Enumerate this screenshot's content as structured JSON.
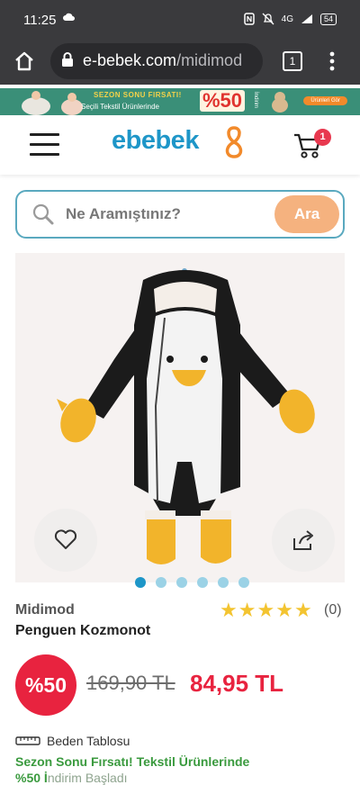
{
  "status": {
    "time": "11:25",
    "lte": "4G",
    "battery": "54"
  },
  "browser": {
    "host": "e-bebek.com",
    "path": "/midimod",
    "tab_count": "1"
  },
  "banner": {
    "line1": "SEZON SONU FIRSATI!",
    "line2": "Seçili Tekstil Ürünlerinde",
    "percent": "%50",
    "suffix": "İndirim",
    "cta": "Ürünleri Gör"
  },
  "header": {
    "logo": "ebebek",
    "cart_count": "1"
  },
  "search": {
    "placeholder": "Ne Aramıştınız?",
    "button": "Ara"
  },
  "gallery": {
    "slides": 6,
    "active_slide": 0
  },
  "product": {
    "brand": "Midimod",
    "name": "Penguen Kozmonot",
    "rating_count": "(0)",
    "rating": 0,
    "discount": "%50",
    "old_price": "169,90 TL",
    "new_price": "84,95 TL"
  },
  "links": {
    "size_chart": "Beden Tablosu",
    "promo": "Sezon Sonu Fırsatı! Tekstil Ürünlerinde",
    "promo2": "%50 İ",
    "promo2_rest": "ndirim Başladı"
  },
  "colors": {
    "brand_blue": "#1e96c8",
    "sale_red": "#e8233f",
    "promo_green": "#3a9a3e",
    "search_button": "#f5b27f"
  }
}
